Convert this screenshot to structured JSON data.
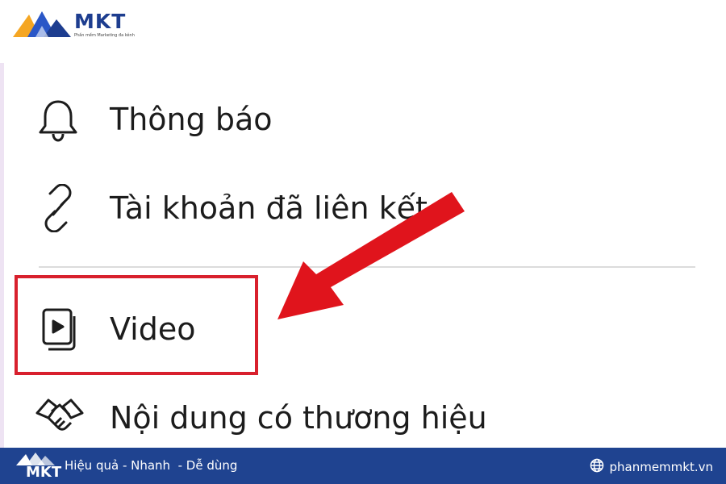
{
  "brand": {
    "name": "MKT",
    "tagline": "Phần mềm Marketing đa kênh",
    "colors": {
      "primary": "#1d3d8f",
      "accent": "#f5a623",
      "highlight": "#d8202d",
      "footer": "#1f4390"
    }
  },
  "menu": {
    "items": [
      {
        "label": "Thông báo",
        "icon": "bell-icon"
      },
      {
        "label": "Tài khoản đã liên kết",
        "icon": "link-icon"
      },
      {
        "label": "Video",
        "icon": "video-icon",
        "highlighted": true
      },
      {
        "label": "Nội dung có thương hiệu",
        "icon": "handshake-icon"
      }
    ]
  },
  "footer": {
    "logo_text": "MKT",
    "slogan": "Hiệu quả - Nhanh  - Dễ dùng",
    "website": "phanmemmkt.vn",
    "website_icon": "globe-icon"
  }
}
